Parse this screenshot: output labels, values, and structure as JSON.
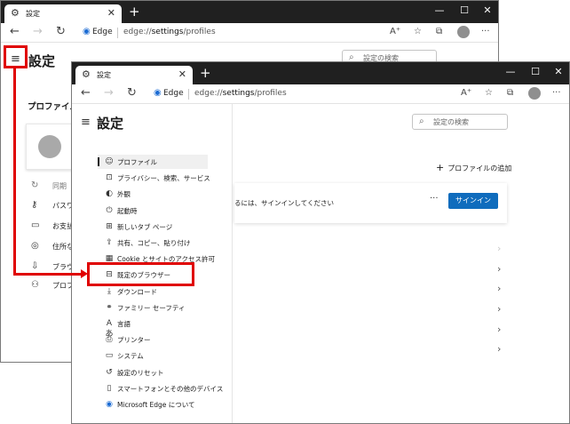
{
  "browser": {
    "tab_title": "設定",
    "tab_close": "✕",
    "new_tab": "+",
    "min_glyph": "—",
    "max_glyph": "☐",
    "close_glyph": "✕",
    "brand": "Edge",
    "url_prefix": "edge://",
    "url_bold": "settings",
    "url_suffix": "/profiles"
  },
  "settings": {
    "title": "設定",
    "search_placeholder": "設定の検索"
  },
  "back_window": {
    "profile_title": "プロファイル",
    "rows": [
      {
        "label": "同期",
        "icon": "sync-icon",
        "dim": true
      },
      {
        "label": "パスワー",
        "icon": "key-icon",
        "dim": false
      },
      {
        "label": "お支払",
        "icon": "card-icon",
        "dim": false
      },
      {
        "label": "住所な",
        "icon": "location-icon",
        "dim": false
      },
      {
        "label": "ブラウザ",
        "icon": "import-icon",
        "dim": false
      },
      {
        "label": "プロフ",
        "icon": "profile-settings-icon",
        "dim": false
      }
    ]
  },
  "sidebar": {
    "items": [
      {
        "label": "プロファイル",
        "icon": "profile-icon"
      },
      {
        "label": "プライバシー、検索、サービス",
        "icon": "lock-icon"
      },
      {
        "label": "外観",
        "icon": "appearance-icon"
      },
      {
        "label": "起動時",
        "icon": "power-icon"
      },
      {
        "label": "新しいタブ ページ",
        "icon": "new-tab-icon"
      },
      {
        "label": "共有、コピー、貼り付け",
        "icon": "share-icon"
      },
      {
        "label": "Cookie とサイトのアクセス許可",
        "icon": "cookie-icon"
      },
      {
        "label": "既定のブラウザー",
        "icon": "default-browser-icon"
      },
      {
        "label": "ダウンロード",
        "icon": "download-icon"
      },
      {
        "label": "ファミリー セーフティ",
        "icon": "family-icon"
      },
      {
        "label": "言語",
        "icon": "language-icon"
      },
      {
        "label": "プリンター",
        "icon": "printer-icon"
      },
      {
        "label": "システム",
        "icon": "system-icon"
      },
      {
        "label": "設定のリセット",
        "icon": "reset-icon"
      },
      {
        "label": "スマートフォンとその他のデバイス",
        "icon": "phone-icon"
      },
      {
        "label": "Microsoft Edge について",
        "icon": "edge-icon"
      }
    ]
  },
  "main": {
    "add_profile": "プロファイルの追加",
    "signin_text": "るには、サインインしてください",
    "more": "···",
    "signin_button": "サインイン"
  },
  "colors": {
    "highlight": "#e00000",
    "accent": "#0f6cbd"
  }
}
